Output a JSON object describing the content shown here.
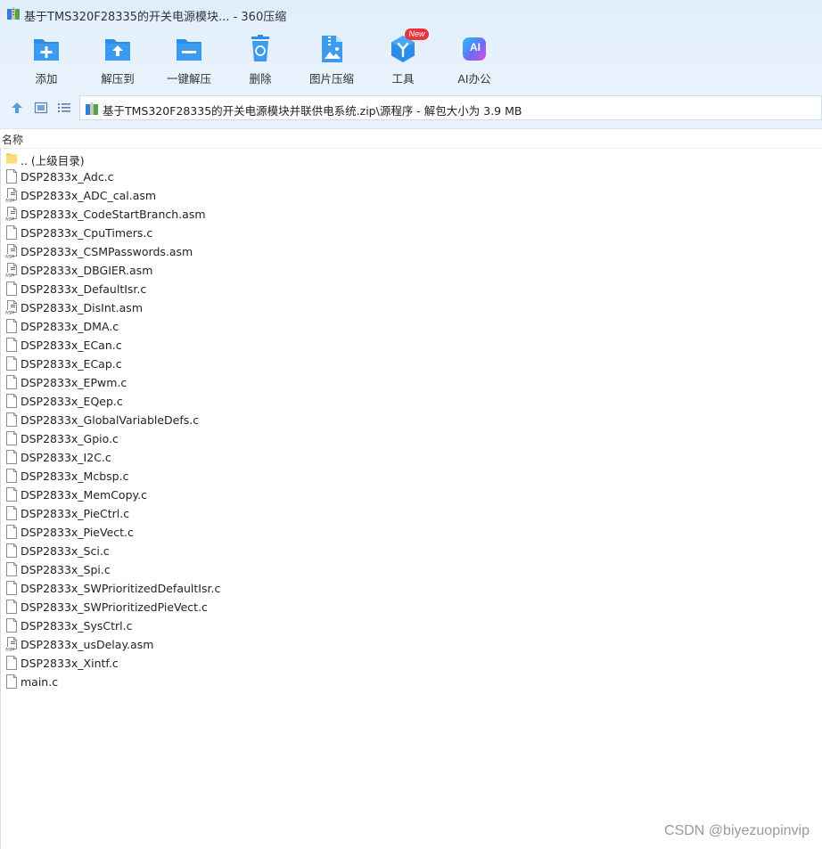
{
  "window": {
    "title": "基于TMS320F28335的开关电源模块... - 360压缩"
  },
  "toolbar": {
    "items": [
      {
        "label": "添加",
        "icon": "add-icon"
      },
      {
        "label": "解压到",
        "icon": "extract-to-icon"
      },
      {
        "label": "一键解压",
        "icon": "one-click-extract-icon"
      },
      {
        "label": "删除",
        "icon": "delete-icon"
      },
      {
        "label": "图片压缩",
        "icon": "image-compress-icon"
      },
      {
        "label": "工具",
        "icon": "tools-icon"
      },
      {
        "label": "AI办公",
        "icon": "ai-office-icon"
      }
    ],
    "tools_badge": "New",
    "ai_icon_text": "AI"
  },
  "address": {
    "path": "基于TMS320F28335的开关电源模块并联供电系统.zip\\源程序 - 解包大小为 3.9 MB"
  },
  "list": {
    "column_name": "名称",
    "items": [
      {
        "name": ".. (上级目录)",
        "type": "folder"
      },
      {
        "name": "DSP2833x_Adc.c",
        "type": "c"
      },
      {
        "name": "DSP2833x_ADC_cal.asm",
        "type": "asm"
      },
      {
        "name": "DSP2833x_CodeStartBranch.asm",
        "type": "asm"
      },
      {
        "name": "DSP2833x_CpuTimers.c",
        "type": "c"
      },
      {
        "name": "DSP2833x_CSMPasswords.asm",
        "type": "asm"
      },
      {
        "name": "DSP2833x_DBGIER.asm",
        "type": "asm"
      },
      {
        "name": "DSP2833x_DefaultIsr.c",
        "type": "c"
      },
      {
        "name": "DSP2833x_DisInt.asm",
        "type": "asm"
      },
      {
        "name": "DSP2833x_DMA.c",
        "type": "c"
      },
      {
        "name": "DSP2833x_ECan.c",
        "type": "c"
      },
      {
        "name": "DSP2833x_ECap.c",
        "type": "c"
      },
      {
        "name": "DSP2833x_EPwm.c",
        "type": "c"
      },
      {
        "name": "DSP2833x_EQep.c",
        "type": "c"
      },
      {
        "name": "DSP2833x_GlobalVariableDefs.c",
        "type": "c"
      },
      {
        "name": "DSP2833x_Gpio.c",
        "type": "c"
      },
      {
        "name": "DSP2833x_I2C.c",
        "type": "c"
      },
      {
        "name": "DSP2833x_Mcbsp.c",
        "type": "c"
      },
      {
        "name": "DSP2833x_MemCopy.c",
        "type": "c"
      },
      {
        "name": "DSP2833x_PieCtrl.c",
        "type": "c"
      },
      {
        "name": "DSP2833x_PieVect.c",
        "type": "c"
      },
      {
        "name": "DSP2833x_Sci.c",
        "type": "c"
      },
      {
        "name": "DSP2833x_Spi.c",
        "type": "c"
      },
      {
        "name": "DSP2833x_SWPrioritizedDefaultIsr.c",
        "type": "c"
      },
      {
        "name": "DSP2833x_SWPrioritizedPieVect.c",
        "type": "c"
      },
      {
        "name": "DSP2833x_SysCtrl.c",
        "type": "c"
      },
      {
        "name": "DSP2833x_usDelay.asm",
        "type": "asm"
      },
      {
        "name": "DSP2833x_Xintf.c",
        "type": "c"
      },
      {
        "name": "main.c",
        "type": "c"
      }
    ]
  },
  "watermark": "CSDN @biyezuopinvip",
  "colors": {
    "accent": "#2d8ee8",
    "chrome_bg": "#e6f1fc",
    "badge": "#e8353b"
  }
}
